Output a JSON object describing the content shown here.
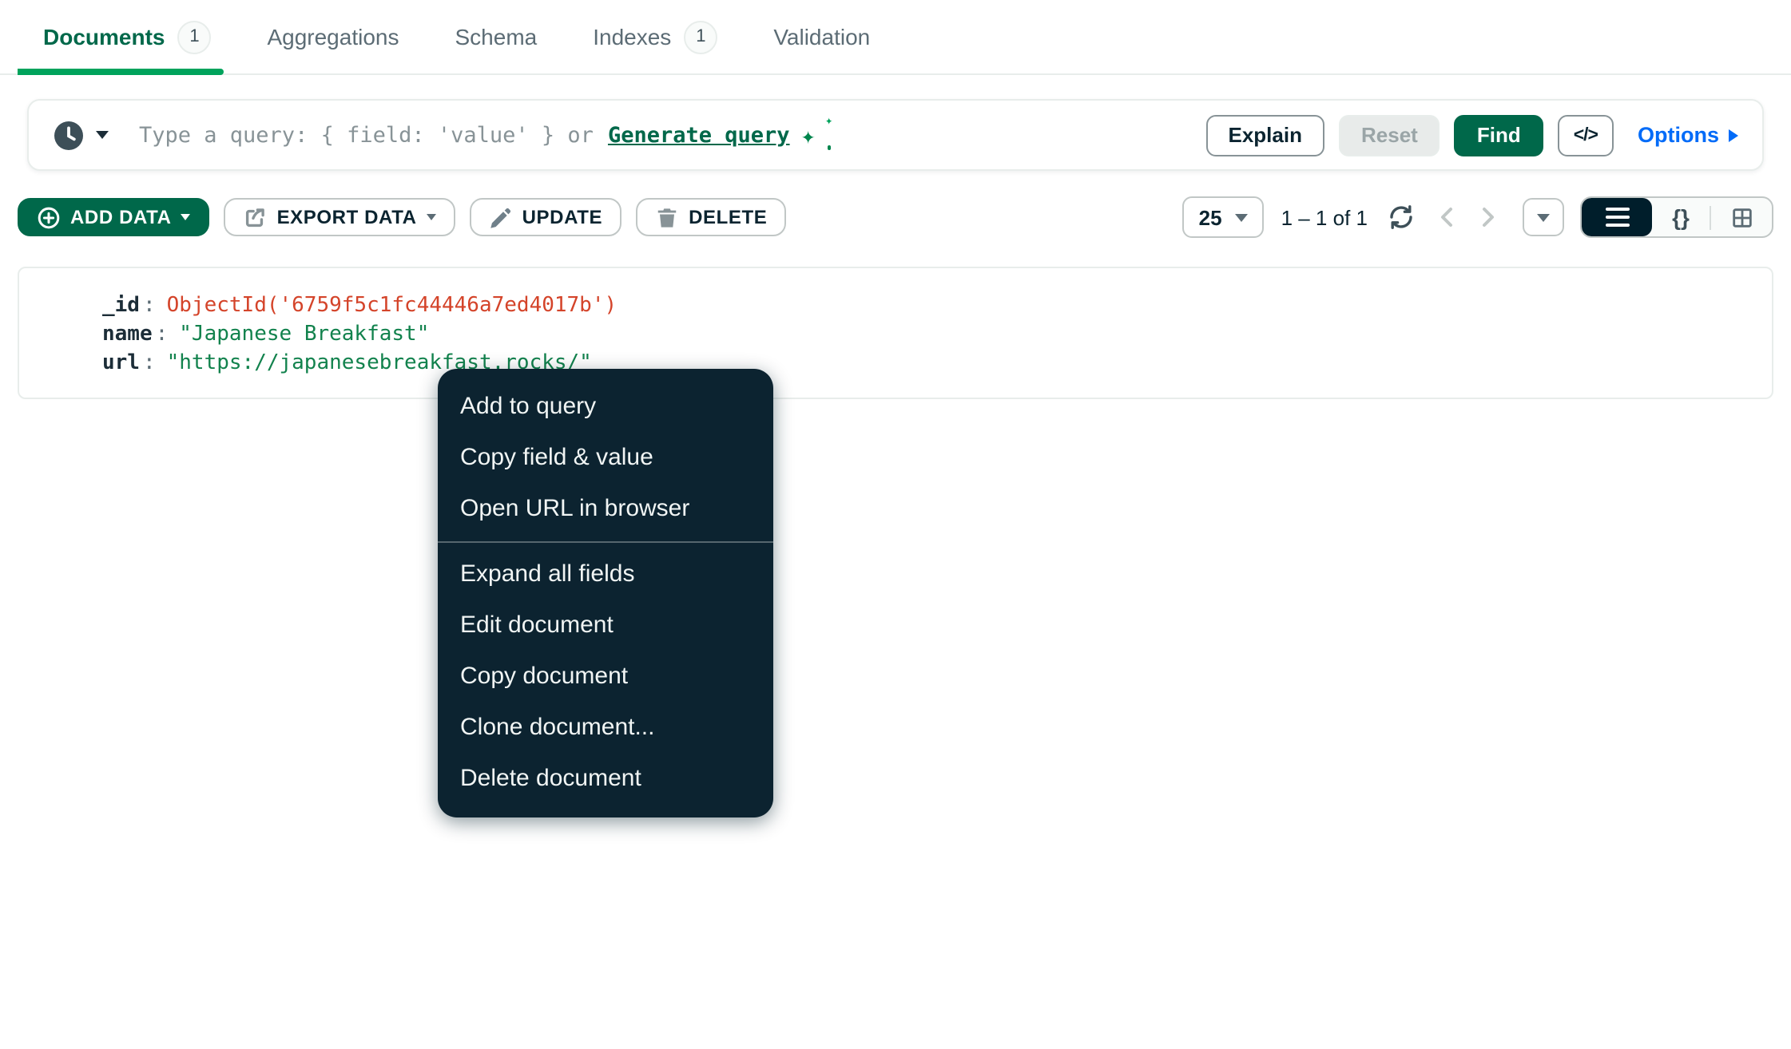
{
  "tabs": [
    {
      "label": "Documents",
      "count": "1"
    },
    {
      "label": "Aggregations"
    },
    {
      "label": "Schema"
    },
    {
      "label": "Indexes",
      "count": "1"
    },
    {
      "label": "Validation"
    }
  ],
  "query_bar": {
    "placeholder_prefix": "Type a query: { field: 'value' } or",
    "generate_label": "Generate query",
    "explain_label": "Explain",
    "reset_label": "Reset",
    "find_label": "Find",
    "options_label": "Options"
  },
  "toolbar": {
    "add_data_label": "ADD DATA",
    "export_data_label": "EXPORT DATA",
    "update_label": "UPDATE",
    "delete_label": "DELETE"
  },
  "pagination": {
    "page_size": "25",
    "range_label": "1 – 1 of 1"
  },
  "document": {
    "fields": [
      {
        "key": "_id",
        "sep": ":",
        "value": "ObjectId('6759f5c1fc44446a7ed4017b')",
        "type": "objectid"
      },
      {
        "key": "name",
        "sep": ":",
        "value": "\"Japanese Breakfast\"",
        "type": "string"
      },
      {
        "key": "url",
        "sep": ":",
        "value": "\"https://japanesebreakfast.rocks/\"",
        "type": "string"
      }
    ]
  },
  "context_menu": {
    "groups": [
      {
        "items": [
          {
            "label": "Add to query"
          },
          {
            "label": "Copy field & value"
          },
          {
            "label": "Open URL in browser"
          }
        ]
      },
      {
        "items": [
          {
            "label": "Expand all fields"
          },
          {
            "label": "Edit document"
          },
          {
            "label": "Copy document"
          },
          {
            "label": "Clone document..."
          },
          {
            "label": "Delete document"
          }
        ]
      }
    ]
  },
  "icons": {
    "sparkle": "✦",
    "braces_glyph": "{}",
    "code_glyph": "</>"
  },
  "colors": {
    "brand_green": "#00684A",
    "tab_underline_green": "#00A35C",
    "link_blue": "#016BF8",
    "menu_bg": "#0C2330",
    "objectid_red": "#D4442A",
    "string_green": "#12824D"
  }
}
